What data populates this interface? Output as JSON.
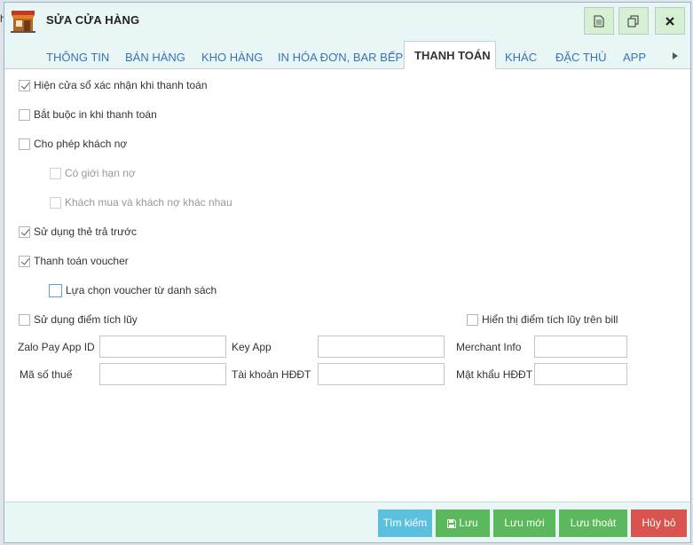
{
  "edge_text": "h",
  "dialog": {
    "title": "SỬA CỬA HÀNG",
    "title_buttons": [
      {
        "icon": "document-icon"
      },
      {
        "icon": "copy-icon"
      },
      {
        "icon": "close-icon"
      }
    ]
  },
  "tabs": [
    {
      "label": "THÔNG TIN",
      "active": false
    },
    {
      "label": "BÁN HÀNG",
      "active": false
    },
    {
      "label": "KHO HÀNG",
      "active": false
    },
    {
      "label": "IN HÓA ĐƠN, BAR BẾP",
      "active": false
    },
    {
      "label": "THANH TOÁN",
      "active": true
    },
    {
      "label": "KHÁC",
      "active": false
    },
    {
      "label": "ĐẶC THÙ",
      "active": false
    },
    {
      "label": "APP",
      "active": false
    }
  ],
  "options": [
    {
      "label": "Hiện cửa sổ xác nhận khi thanh toán",
      "checked": true
    },
    {
      "label": "Bắt buộc in khi thanh toán",
      "checked": false
    },
    {
      "label": "Cho phép khách nợ",
      "checked": false
    },
    {
      "label": "Có giới hạn nợ",
      "checked": false,
      "disabled": true
    },
    {
      "label": "Khách mua và khách nợ khác nhau",
      "checked": false,
      "disabled": true
    },
    {
      "label": "Sử dụng thẻ trả trước",
      "checked": true
    },
    {
      "label": "Thanh toán voucher",
      "checked": true
    },
    {
      "label": "Lựa chọn voucher từ danh sách",
      "checked": false
    },
    {
      "label": "Sử dụng điểm tích lũy",
      "checked": false
    },
    {
      "label": "Hiển thị điểm tích lũy trên bill",
      "checked": false
    }
  ],
  "fields": {
    "zalo_label": "Zalo Pay App ID",
    "zalo_value": "",
    "keyapp_label": "Key App",
    "keyapp_value": "",
    "merchant_label": "Merchant Info",
    "merchant_value": "",
    "tax_label": "Mã số thuế",
    "tax_value": "",
    "account_label": "Tài  khoản HĐĐT",
    "account_value": "",
    "password_label": "Mật khẩu HĐĐT",
    "password_value": ""
  },
  "footer": {
    "search": "Tìm kiếm",
    "save": "Lưu",
    "save_new": "Lưu mới",
    "save_exit": "Lưu thoát",
    "cancel": "Hủy bỏ"
  },
  "colors": {
    "info": "#5bc0de",
    "success": "#5cb85c",
    "danger": "#d9534f",
    "tab_text": "#3a73b5",
    "header_bg": "#e9f6f6"
  }
}
